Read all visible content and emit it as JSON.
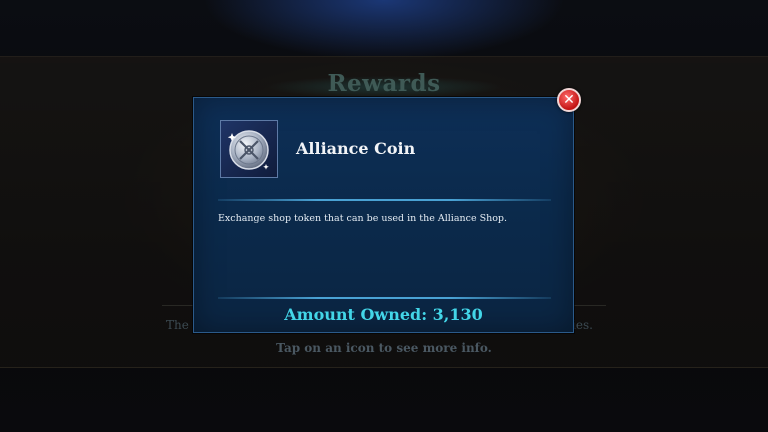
{
  "background": {
    "title": "Rewards",
    "left_text": "The",
    "right_text": "ies.",
    "hint": "Tap on an icon to see more info."
  },
  "modal": {
    "item_name": "Alliance Coin",
    "item_icon": "alliance-coin-icon",
    "description": "Exchange shop token that can be used in the Alliance Shop.",
    "amount_owned": "Amount Owned: 3,130",
    "close_icon": "close-icon"
  },
  "colors": {
    "modal_bg": "#0b2a4c",
    "divider": "#4aa2d4",
    "amount_text": "#43d6e8",
    "close_button": "#c21313"
  }
}
